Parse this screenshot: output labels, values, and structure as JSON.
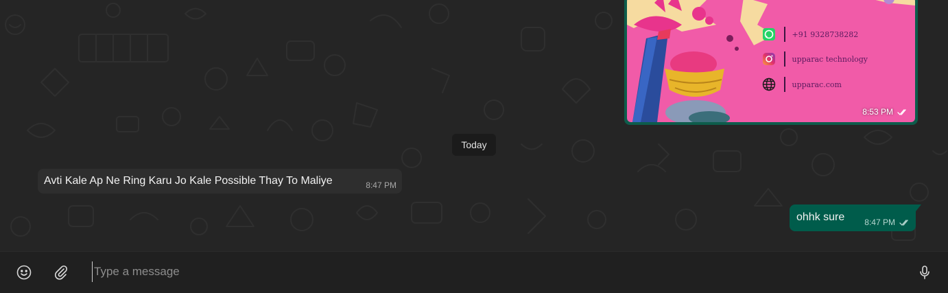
{
  "image_message": {
    "time": "8:53 PM",
    "status": "read",
    "contacts": [
      {
        "icon": "whatsapp-icon",
        "text": "+91 9328738282"
      },
      {
        "icon": "instagram-icon",
        "text": "upparac technology"
      },
      {
        "icon": "globe-icon",
        "text": "upparac.com"
      }
    ]
  },
  "date_divider": "Today",
  "incoming_message": {
    "text": "Avti Kale Ap Ne Ring Karu Jo Kale Possible Thay To Maliye",
    "time": "8:47 PM"
  },
  "outgoing_message": {
    "text": "ohhk sure",
    "time": "8:47 PM",
    "status": "read"
  },
  "composer": {
    "placeholder": "Type a message",
    "value": ""
  },
  "colors": {
    "chat_background": "#252525",
    "outgoing_bubble": "#005c4b",
    "incoming_bubble": "#2e2e2e",
    "composer_background": "#202020",
    "image_background_pink": "#f05aa6"
  }
}
